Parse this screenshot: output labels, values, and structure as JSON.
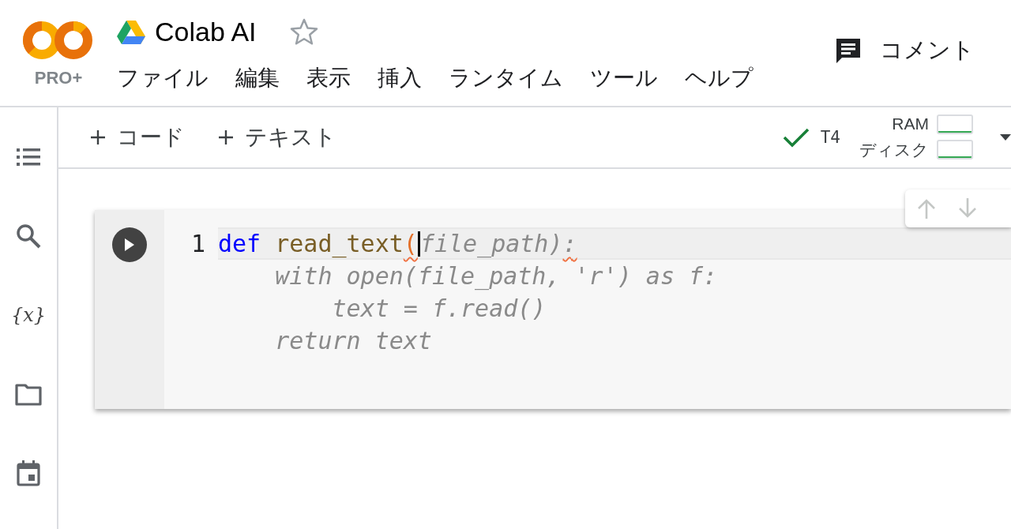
{
  "logo": {
    "badge": "PRO+"
  },
  "title": "Colab AI",
  "starred": false,
  "menu": [
    "ファイル",
    "編集",
    "表示",
    "挿入",
    "ランタイム",
    "ツール",
    "ヘルプ"
  ],
  "comment_button": "コメント",
  "sidebar": [
    {
      "kind": "toc"
    },
    {
      "kind": "search"
    },
    {
      "kind": "variables",
      "text": "{x}"
    },
    {
      "kind": "folder"
    },
    {
      "kind": "calendar"
    }
  ],
  "toolbar": {
    "add_buttons": [
      "コード",
      "テキスト"
    ],
    "runtime": {
      "connected": true,
      "label": "T4"
    },
    "meters": [
      {
        "label": "RAM"
      },
      {
        "label": "ディスク"
      }
    ]
  },
  "cell": {
    "line_number": "1",
    "lines": [
      [
        {
          "text": "def ",
          "kind": "keyword"
        },
        {
          "text": "read_text",
          "kind": "function"
        },
        {
          "text": "(",
          "kind": "bracket",
          "squiggle": true,
          "cursor": true
        },
        {
          "text": "file_path)",
          "kind": "ghost"
        },
        {
          "text": ":",
          "kind": "ghost",
          "squiggle": true
        }
      ],
      [
        {
          "text": "    with open(file_path, 'r') as f:",
          "kind": "ghost"
        }
      ],
      [
        {
          "text": "        text = f.read()",
          "kind": "ghost"
        }
      ],
      [
        {
          "text": "    return text",
          "kind": "ghost"
        }
      ]
    ]
  }
}
